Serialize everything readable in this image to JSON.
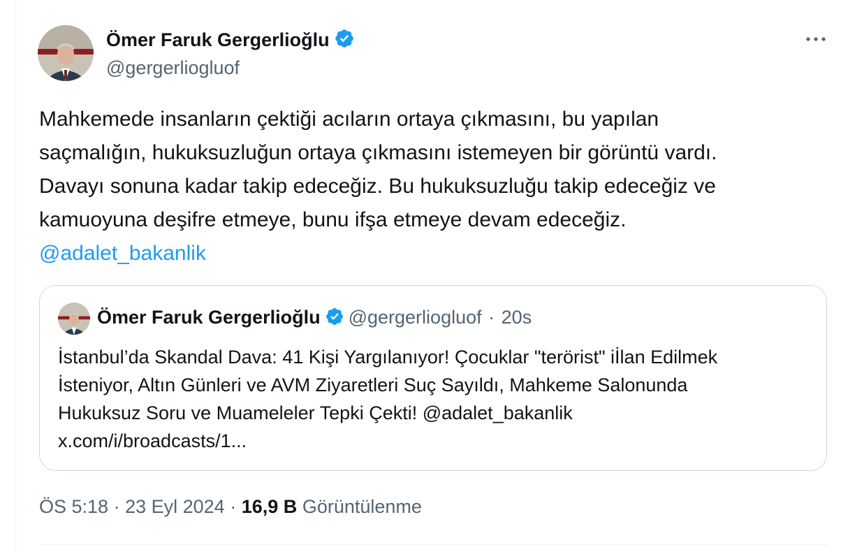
{
  "colors": {
    "accent": "#1d9bf0",
    "text": "#0f1419",
    "muted": "#536471",
    "border": "#cfd9de"
  },
  "tweet": {
    "author": {
      "name": "Ömer Faruk Gergerlioğlu",
      "handle": "@gergerliogluof",
      "verified_icon": "verified-badge-icon"
    },
    "more_icon": "more-options-icon",
    "text_lines": [
      "Mahkemede insanların çektiği acıların ortaya çıkmasını, bu yapılan",
      "saçmalığın, hukuksuzluğun ortaya çıkmasını istemeyen bir görüntü vardı.",
      "Davayı sonuna kadar takip edeceğiz. Bu hukuksuzluğu takip edeceğiz ve",
      "kamuoyuna deşifre etmeye, bunu ifşa etmeye devam edeceğiz."
    ],
    "mention": "@adalet_bakanlik"
  },
  "quote": {
    "name": "Ömer Faruk Gergerlioğlu",
    "handle": "@gergerliogluof",
    "separator": "·",
    "time": "20s",
    "text_lines": [
      "İstanbul’da Skandal Dava: 41 Kişi Yargılanıyor! Çocuklar \"terörist\" iİlan Edilmek",
      "İsteniyor, Altın Günleri ve AVM Ziyaretleri Suç Sayıldı, Mahkeme Salonunda",
      "Hukuksuz Soru ve Muameleler Tepki Çekti! @adalet_bakanlik",
      "x.com/i/broadcasts/1..."
    ]
  },
  "footer": {
    "time": "ÖS 5:18",
    "separator": "·",
    "date": "23 Eyl 2024",
    "views_count": "16,9 B",
    "views_label": "Görüntülenme"
  }
}
